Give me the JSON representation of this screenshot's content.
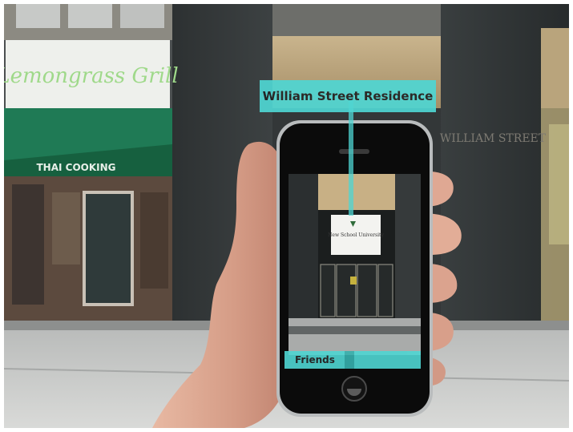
{
  "ar_label": {
    "text": "William Street Residence"
  },
  "storefront": {
    "awning_text": "THAI COOKING",
    "sign_text": "Lemongrass Grill"
  },
  "building": {
    "plaque_text": "WILLIAM STREET"
  },
  "phone_screen": {
    "banner_text": "New School University",
    "bottom_bar_label": "Friends"
  },
  "colors": {
    "accent": "#4fd6d3",
    "awning": "#1f7a55",
    "sign_text": "#9fd98a"
  },
  "icons": {
    "home_button": "home-button-icon",
    "speaker": "speaker-slot"
  }
}
